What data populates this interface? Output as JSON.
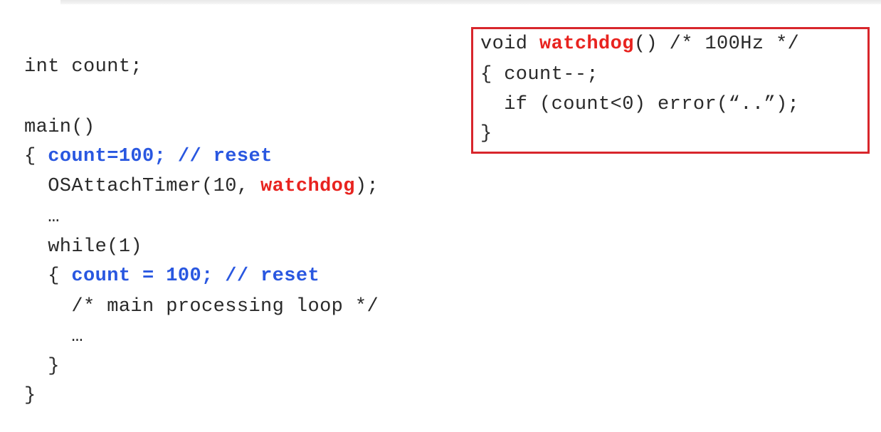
{
  "main_code": {
    "decl": "int count;",
    "main_sig": "main()",
    "brace_count_reset": "{ ",
    "count_reset_1": "count=100; // reset",
    "attach_prefix": "  OSAttachTimer(10, ",
    "attach_fn": "watchdog",
    "attach_suffix": ");",
    "ellipsis_1": "  …",
    "while_line": "  while(1)",
    "brace_inner": "  { ",
    "count_reset_2": "count = 100; // reset",
    "comment_line": "    /* main processing loop */",
    "ellipsis_2": "    …",
    "close_inner": "  }",
    "close_outer": "}"
  },
  "watchdog_code": {
    "sig_prefix": "void ",
    "fn_name": "watchdog",
    "sig_suffix": "() /* 100Hz */",
    "line_decrement": "{ count--;",
    "line_if": "  if (count<0) error(“..”);",
    "line_close": "}"
  },
  "colors": {
    "keyword_blue": "#2957e0",
    "function_red": "#e8231f",
    "box_border": "#d8262c"
  }
}
